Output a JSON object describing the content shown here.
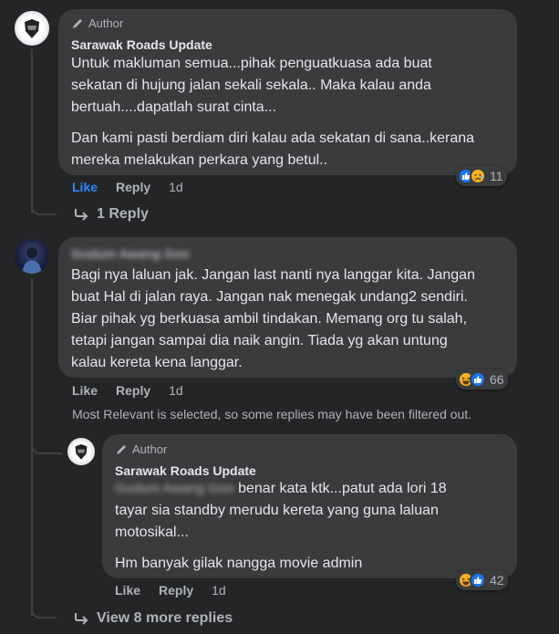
{
  "comment1": {
    "badge": "Author",
    "name": "Sarawak Roads Update",
    "para1_lines": [
      "Untuk makluman semua...pihak penguatkuasa ada buat",
      "sekatan di hujung jalan sekali sekala.. Maka kalau anda",
      "bertuah....dapatlah surat cinta..."
    ],
    "para2_lines": [
      "Dan kami pasti berdiam diri kalau ada sekatan di sana..kerana",
      "mereka melakukan perkara yang betul.."
    ],
    "reactions": {
      "count": "11",
      "icons": [
        "like-icon",
        "sad-icon"
      ]
    },
    "actions": {
      "like": "Like",
      "reply": "Reply",
      "time": "1d"
    },
    "replies_link": "1 Reply"
  },
  "comment2": {
    "name_blurred": "Gudum Awang Gon",
    "lines": [
      "Bagi nya laluan jak. Jangan last nanti nya langgar kita. Jangan",
      "buat Hal di jalan raya. Jangan nak menegak undang2 sendiri.",
      "Biar pihak yg berkuasa ambil tindakan. Memang org tu salah,",
      "tetapi jangan sampai dia naik angin. Tiada yg akan untung",
      "kalau kereta kena langgar."
    ],
    "reactions": {
      "count": "66",
      "icons": [
        "haha-icon",
        "like-icon"
      ]
    },
    "actions": {
      "like": "Like",
      "reply": "Reply",
      "time": "1d"
    },
    "filter_notice": "Most Relevant is selected, so some replies may have been filtered out."
  },
  "reply1": {
    "badge": "Author",
    "name": "Sarawak Roads Update",
    "mention_blurred": "Gudum Awang Gon",
    "line1_rest": "benar kata ktk...patut ada lori 18",
    "lines": [
      "tayar sia standby merudu kereta yang guna laluan",
      "motosikal..."
    ],
    "para2": "Hm banyak gilak nangga movie admin",
    "reactions": {
      "count": "42",
      "icons": [
        "haha-icon",
        "like-icon"
      ]
    },
    "actions": {
      "like": "Like",
      "reply": "Reply",
      "time": "1d"
    }
  },
  "more_replies": "View 8 more replies",
  "colors": {
    "background": "#242526",
    "bubble": "#3a3b3c",
    "like_blue": "#2d88ff",
    "muted": "#b0b3b8"
  }
}
